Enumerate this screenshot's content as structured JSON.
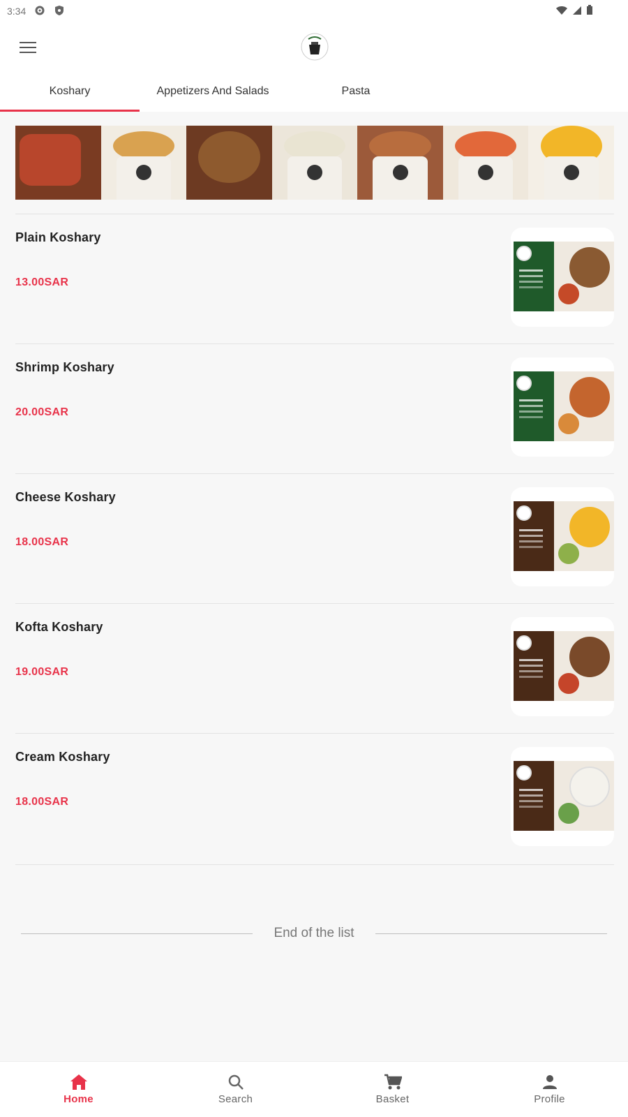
{
  "status_bar": {
    "time": "3:34"
  },
  "app": {
    "logo_name": "restaurant-logo"
  },
  "tabs": [
    {
      "label": "Koshary",
      "active": true
    },
    {
      "label": "Appetizers And Salads",
      "active": false
    },
    {
      "label": "Pasta",
      "active": false
    }
  ],
  "menu_items": [
    {
      "name": "Plain Koshary",
      "price": "13.00SAR",
      "thumb_theme": "green"
    },
    {
      "name": "Shrimp Koshary",
      "price": "20.00SAR",
      "thumb_theme": "green"
    },
    {
      "name": "Cheese Koshary",
      "price": "18.00SAR",
      "thumb_theme": "brown"
    },
    {
      "name": "Kofta Koshary",
      "price": "19.00SAR",
      "thumb_theme": "brown"
    },
    {
      "name": "Cream Koshary",
      "price": "18.00SAR",
      "thumb_theme": "brown"
    }
  ],
  "end_of_list": "End of the list",
  "bottom_nav": {
    "items": [
      {
        "label": "Home",
        "icon": "home-icon",
        "active": true
      },
      {
        "label": "Search",
        "icon": "search-icon",
        "active": false
      },
      {
        "label": "Basket",
        "icon": "cart-icon",
        "active": false
      },
      {
        "label": "Profile",
        "icon": "profile-icon",
        "active": false
      }
    ]
  },
  "colors": {
    "accent": "#e8334a",
    "thumb_green": "#1f5a2a",
    "thumb_brown": "#4a2a17"
  }
}
